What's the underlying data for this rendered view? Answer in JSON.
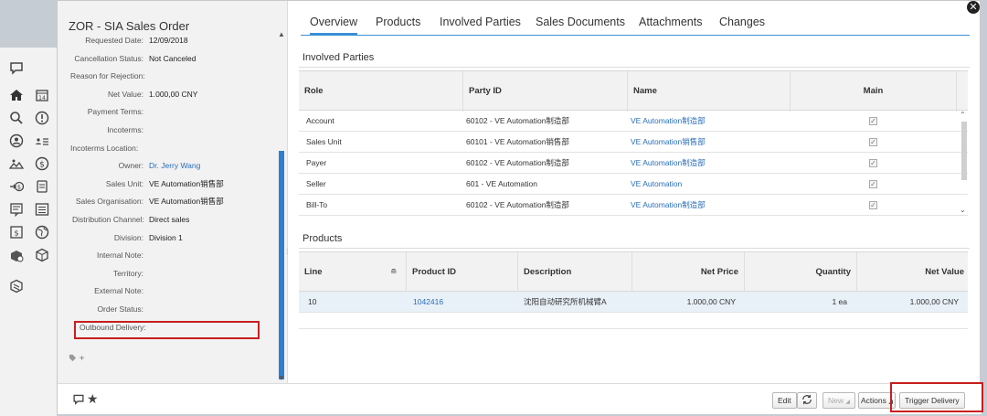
{
  "header": {
    "title": "ZOR - SIA Sales Order"
  },
  "details": {
    "fields": [
      {
        "label": "Requested Date:",
        "value": "12/09/2018"
      },
      {
        "label": "Cancellation Status:",
        "value": "Not Canceled"
      },
      {
        "label": "Reason for Rejection:",
        "value": ""
      },
      {
        "label": "Net Value:",
        "value": "1.000,00 CNY"
      },
      {
        "label": "Payment Terms:",
        "value": ""
      },
      {
        "label": "Incoterms:",
        "value": ""
      },
      {
        "label": "Incoterms Location:",
        "value": ""
      },
      {
        "label": "Owner:",
        "value": "Dr. Jerry Wang"
      },
      {
        "label": "Sales Unit:",
        "value": "VE Automation销售部"
      },
      {
        "label": "Sales Organisation:",
        "value": "VE Automation销售部"
      },
      {
        "label": "Distribution Channel:",
        "value": "Direct sales"
      },
      {
        "label": "Division:",
        "value": "Division 1"
      },
      {
        "label": "Internal Note:",
        "value": ""
      },
      {
        "label": "Territory:",
        "value": ""
      },
      {
        "label": "External Note:",
        "value": ""
      },
      {
        "label": "Order Status:",
        "value": ""
      },
      {
        "label": "Outbound Delivery:",
        "value": ""
      }
    ],
    "tag_plus": "+"
  },
  "tabs": [
    "Overview",
    "Products",
    "Involved Parties",
    "Sales Documents",
    "Attachments",
    "Changes"
  ],
  "involved_parties": {
    "title": "Involved Parties",
    "columns": [
      "Role",
      "Party ID",
      "Name",
      "Main"
    ],
    "rows": [
      {
        "role": "Account",
        "party_id": "60102 - VE Automation制造部",
        "name": "VE Automation制造部",
        "main": true
      },
      {
        "role": "Sales Unit",
        "party_id": "60101 - VE Automation销售部",
        "name": "VE Automation销售部",
        "main": true
      },
      {
        "role": "Payer",
        "party_id": "60102 - VE Automation制造部",
        "name": "VE Automation制造部",
        "main": true
      },
      {
        "role": "Seller",
        "party_id": "601 - VE Automation",
        "name": "VE Automation",
        "main": true
      },
      {
        "role": "Bill-To",
        "party_id": "60102 - VE Automation制造部",
        "name": "VE Automation制造部",
        "main": true
      }
    ]
  },
  "products": {
    "title": "Products",
    "columns": [
      "Line",
      "Product ID",
      "Description",
      "Net Price",
      "Quantity",
      "Net Value"
    ],
    "rows": [
      {
        "line": "10",
        "product_id": "1042416",
        "description": "沈阳自动研究所机械臂A",
        "net_price": "1.000,00  CNY",
        "quantity": "1  ea",
        "net_value": "1.000,00  CNY"
      }
    ]
  },
  "footer": {
    "edit": "Edit",
    "new": "New",
    "actions": "Actions",
    "trigger_delivery": "Trigger Delivery"
  },
  "colors": {
    "accent": "#3a8fd6",
    "highlight": "#c81e1e",
    "link": "#2a6ebb"
  }
}
